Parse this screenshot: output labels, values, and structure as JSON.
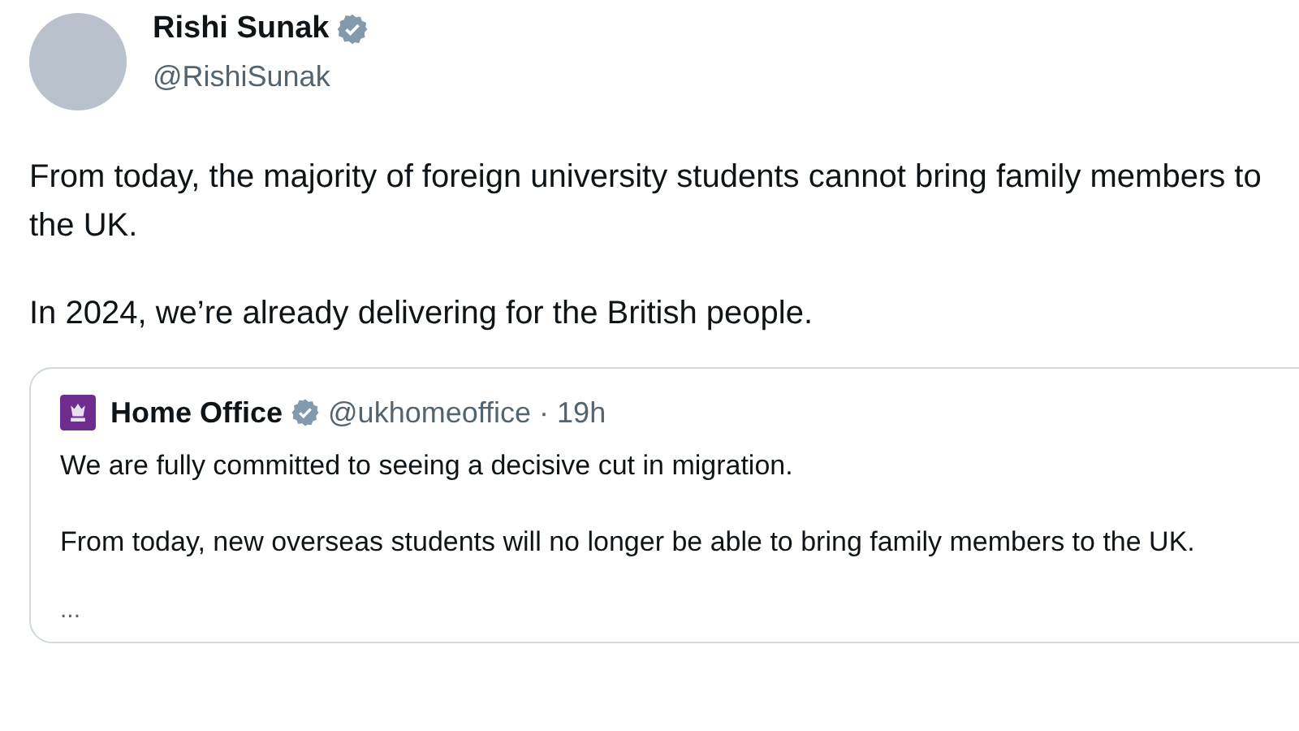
{
  "author": {
    "name": "Rishi Sunak",
    "handle": "@RishiSunak",
    "verified": true
  },
  "paragraphs": [
    "From today, the majority of foreign university students cannot bring family members to the UK.",
    "In 2024, we’re already delivering for the British people."
  ],
  "quoted": {
    "name": "Home Office",
    "verified": true,
    "handle": "@ukhomeoffice",
    "separator": "·",
    "time": "19h",
    "paragraphs": [
      "We are fully committed to seeing a decisive cut in migration.",
      "From today, new overseas students will no longer be able to bring family members to the UK."
    ],
    "more": "..."
  }
}
